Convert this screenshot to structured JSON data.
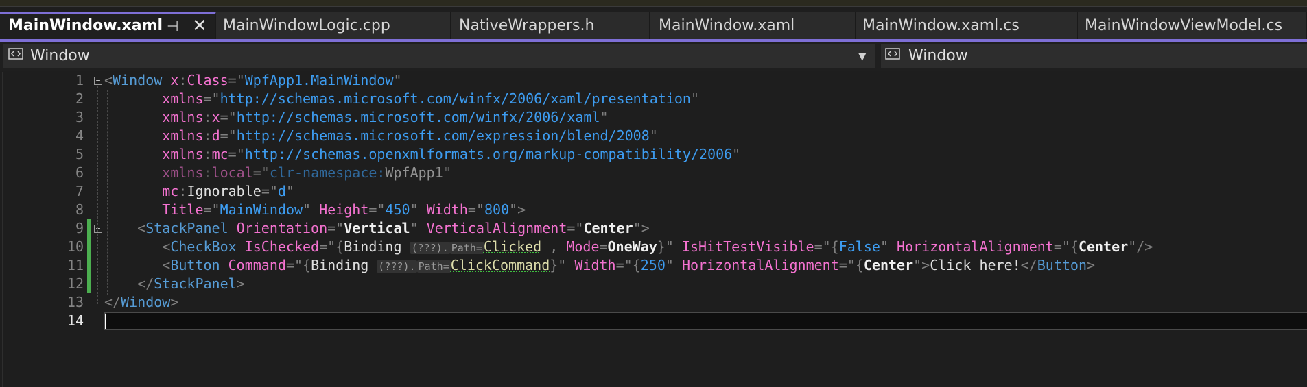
{
  "tabs": [
    {
      "label": "MainWindow.xaml",
      "active": true
    },
    {
      "label": "MainWindowLogic.cpp"
    },
    {
      "label": "NativeWrappers.h"
    },
    {
      "label": "MainWindow.xaml"
    },
    {
      "label": "MainWindow.xaml.cs"
    },
    {
      "label": "MainWindowViewModel.cs"
    }
  ],
  "pin_glyph": "⊣",
  "close_glyph": "✕",
  "nav": {
    "left": "Window",
    "right": "Window"
  },
  "current_line": 14,
  "line_numbers": [
    "1",
    "2",
    "3",
    "4",
    "5",
    "6",
    "7",
    "8",
    "9",
    "10",
    "11",
    "12",
    "13",
    "14"
  ],
  "colors": {
    "accent": "#7e6fd6",
    "tag": "#569cd6",
    "attribute": "#f472d0",
    "string": "#3d9cf0",
    "changed_bar": "#4caf50"
  },
  "code": {
    "l1": {
      "o": "<",
      "t": "Window",
      "a": "x",
      "c": ":",
      "a2": "Class",
      "e": "=\"",
      "v": "WpfApp1.MainWindow",
      "q": "\""
    },
    "l2": {
      "a": "xmlns",
      "e": "=\"",
      "v": "http://schemas.microsoft.com/winfx/2006/xaml/presentation",
      "q": "\""
    },
    "l3": {
      "a": "xmlns",
      "c": ":",
      "a2": "x",
      "e": "=\"",
      "v": "http://schemas.microsoft.com/winfx/2006/xaml",
      "q": "\""
    },
    "l4": {
      "a": "xmlns",
      "c": ":",
      "a2": "d",
      "e": "=\"",
      "v": "http://schemas.microsoft.com/expression/blend/2008",
      "q": "\""
    },
    "l5": {
      "a": "xmlns",
      "c": ":",
      "a2": "mc",
      "e": "=\"",
      "v": "http://schemas.openxmlformats.org/markup-compatibility/2006",
      "q": "\""
    },
    "l6": {
      "a": "xmlns",
      "c": ":",
      "a2": "local",
      "e": "=\"",
      "v": "clr-namespace:",
      "v2": "WpfApp1",
      "q": "\""
    },
    "l7": {
      "a": "mc",
      "c": ":",
      "a2": "Ignorable",
      "e": "=\"",
      "v": "d",
      "q": "\""
    },
    "l8": {
      "a": "Title",
      "e": "=\"",
      "v": "MainWindow",
      "q": "\"",
      "a2": "Height",
      "v2": "450",
      "a3": "Width",
      "v3": "800",
      "end": "\">"
    },
    "l9": {
      "o": "<",
      "t": "StackPanel",
      "a": "Orientation",
      "e": "=\"",
      "v": "Vertical",
      "q": "\"",
      "a2": "VerticalAlignment",
      "v2": "Center",
      "end": "\">"
    },
    "l10": {
      "o": "<",
      "t": "CheckBox",
      "a": "IsChecked",
      "e": "=\"{",
      "b": "Binding",
      "h1": "(???).",
      "h2": "Path=",
      "p": "Clicked",
      "sep": " , ",
      "a2": "Mode",
      "eq": "=",
      "v": "OneWay",
      "cb": "}\"",
      "a3": "IsHitTestVisible",
      "v2": "False",
      "q": "\"",
      "a4": "HorizontalAlignment",
      "v3": "Center",
      "end": "\"/>"
    },
    "l11": {
      "o": "<",
      "t": "Button",
      "a": "Command",
      "e": "=\"{",
      "b": "Binding",
      "h1": "(???).",
      "h2": "Path=",
      "p": "ClickCommand",
      "cb": "}\"",
      "a2": "Width",
      "v": "250",
      "q": "\"",
      "a3": "HorizontalAlignment",
      "v2": "Center",
      "gt": "\">",
      "txt": "Click here!",
      "c": "</",
      "t2": "Button",
      "g": ">"
    },
    "l12": {
      "o": "</",
      "t": "StackPanel",
      "g": ">"
    },
    "l13": {
      "o": "</",
      "t": "Window",
      "g": ">"
    }
  }
}
